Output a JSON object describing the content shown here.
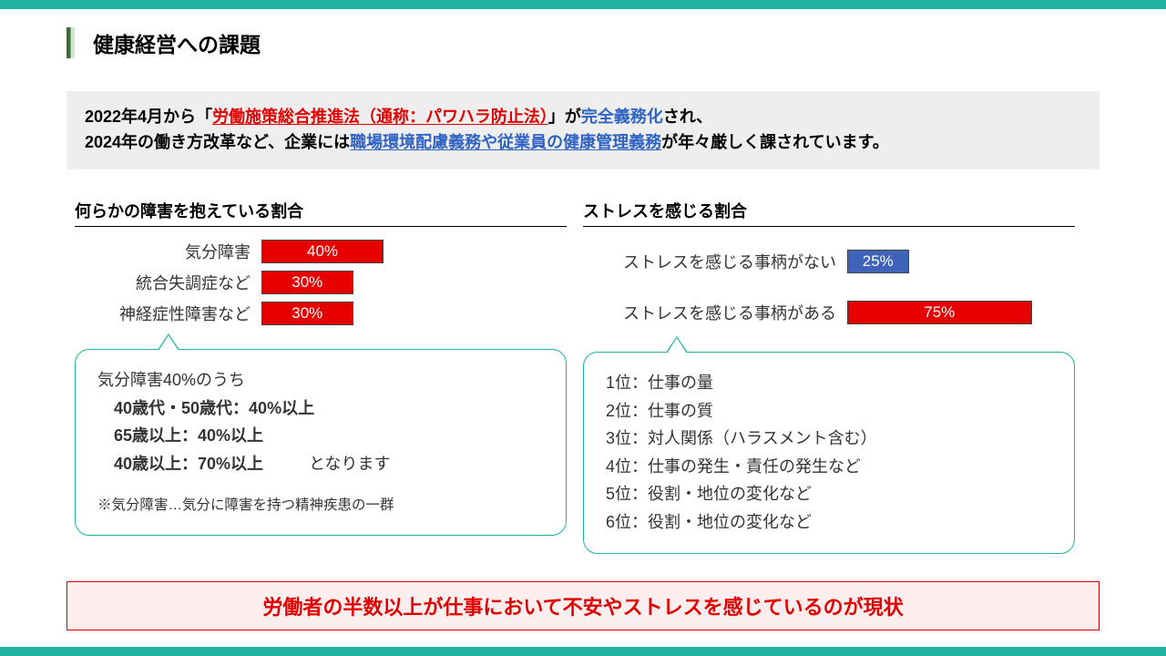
{
  "title": "健康経営への課題",
  "intro": {
    "a": "2022年4月から「",
    "b": "労働施策総合推進法（通称：パワハラ防止法）",
    "c": "」が",
    "d": "完全義務化",
    "e": "され、",
    "f": "2024年の働き方改革など、企業には",
    "g": "職場環境配慮義務や従業員の健康管理義務",
    "h": "が年々厳しく課されています。"
  },
  "left": {
    "heading": "何らかの障害を抱えている割合",
    "callout": {
      "lead": "気分障害40%のうち",
      "line1": "40歳代・50歳代：40%以上",
      "line2": "65歳以上：40%以上",
      "line3": "40歳以上：70%以上",
      "tail": "となります",
      "note": "※気分障害…気分に障害を持つ精神疾患の一群"
    }
  },
  "right": {
    "heading": "ストレスを感じる割合",
    "callout": {
      "r1": "1位：仕事の量",
      "r2": "2位：仕事の質",
      "r3": "3位：対人関係（ハラスメント含む）",
      "r4": "4位：仕事の発生・責任の発生など",
      "r5": "5位：役割・地位の変化など",
      "r6": "6位：役割・地位の変化など"
    }
  },
  "conclusion": "労働者の半数以上が仕事において不安やストレスを感じているのが現状",
  "chart_data": [
    {
      "type": "bar",
      "title": "何らかの障害を抱えている割合",
      "categories": [
        "気分障害",
        "統合失調症など",
        "神経症性障害など"
      ],
      "values": [
        40,
        30,
        30
      ],
      "value_labels": [
        "40%",
        "30%",
        "30%"
      ],
      "colors": [
        "red",
        "red",
        "red"
      ],
      "xlim": [
        0,
        100
      ]
    },
    {
      "type": "bar",
      "title": "ストレスを感じる割合",
      "categories": [
        "ストレスを感じる事柄がない",
        "ストレスを感じる事柄がある"
      ],
      "values": [
        25,
        75
      ],
      "value_labels": [
        "25%",
        "75%"
      ],
      "colors": [
        "blue",
        "red"
      ],
      "xlim": [
        0,
        100
      ]
    }
  ]
}
